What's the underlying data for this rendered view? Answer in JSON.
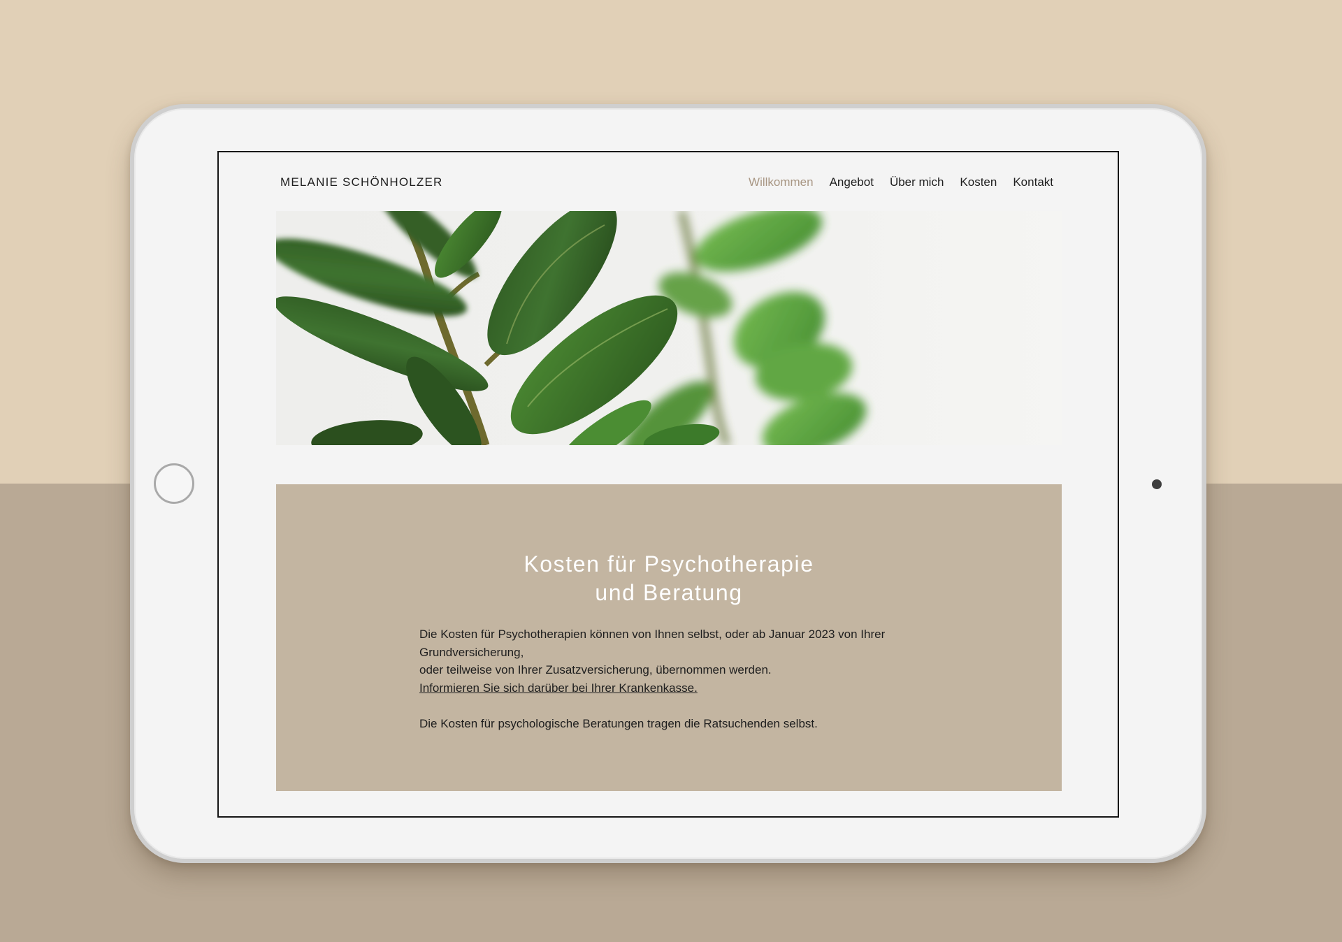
{
  "site": {
    "title": "MELANIE SCHÖNHOLZER"
  },
  "nav": {
    "items": [
      {
        "label": "Willkommen",
        "active": true
      },
      {
        "label": "Angebot",
        "active": false
      },
      {
        "label": "Über mich",
        "active": false
      },
      {
        "label": "Kosten",
        "active": false
      },
      {
        "label": "Kontakt",
        "active": false
      }
    ]
  },
  "hero": {
    "image": "green-plant-leaves-photo"
  },
  "costs": {
    "title_line1": "Kosten für Psychotherapie",
    "title_line2": "und Beratung",
    "paragraph1_line1": "Die Kosten für Psychotherapien können von Ihnen selbst, oder ab Januar 2023 von Ihrer Grundversicherung,",
    "paragraph1_line2": "oder teilweise von Ihrer Zusatzversicherung, übernommen werden.",
    "link_label": "Informieren Sie sich darüber bei Ihrer Krankenkasse.",
    "paragraph2": "Die Kosten für psychologische Beratungen tragen die Ratsuchenden selbst."
  },
  "colors": {
    "background_top": "#e1d0b7",
    "background_bottom": "#b9a995",
    "tablet_body": "#f4f4f4",
    "cost_box": "#c3b5a1",
    "nav_active": "#a89683"
  }
}
